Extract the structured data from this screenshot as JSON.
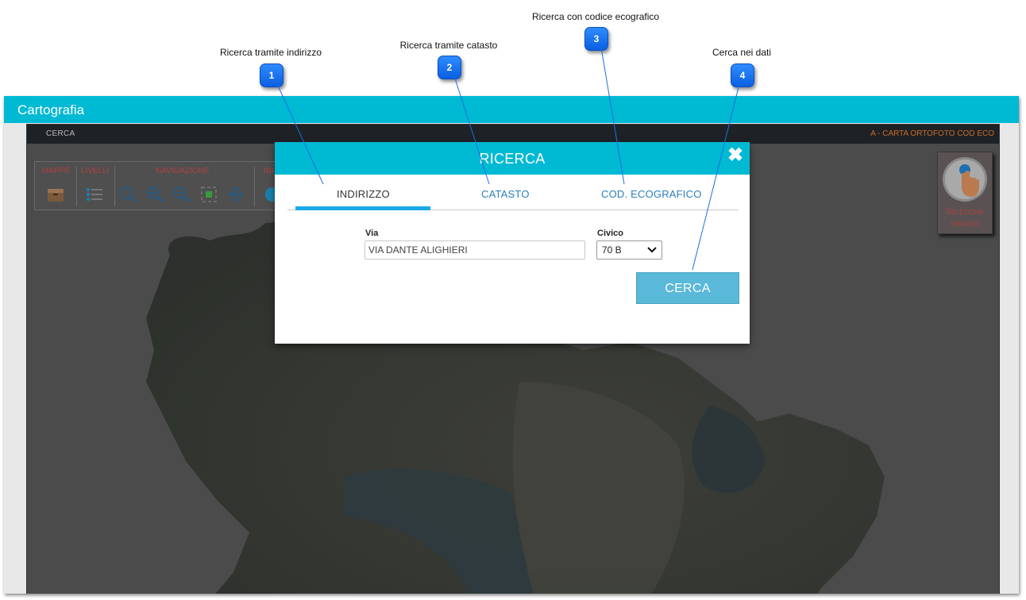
{
  "annotations": [
    {
      "number": "1",
      "label": "Ricerca tramite indirizzo"
    },
    {
      "number": "2",
      "label": "Ricerca tramite catasto"
    },
    {
      "number": "3",
      "label": "Ricerca con codice ecografico"
    },
    {
      "number": "4",
      "label": "Cerca nei dati"
    }
  ],
  "window": {
    "title": "Cartografia"
  },
  "topbar": {
    "search_link": "CERCA",
    "map_name": "A - CARTA ORTOFOTO COD ECO"
  },
  "toolbar": {
    "groups": [
      {
        "label": "MAPPE",
        "icons": [
          "map-archive-icon"
        ]
      },
      {
        "label": "LIVELLI",
        "icons": [
          "layers-list-icon"
        ]
      },
      {
        "label": "NAVIGAZIONE",
        "icons": [
          "search-icon",
          "zoom-in-icon",
          "zoom-out-icon",
          "zoom-extent-icon",
          "pan-icon"
        ]
      },
      {
        "label": "INI",
        "icons": [
          "info-icon"
        ]
      }
    ]
  },
  "select_building": {
    "label_line1": "Seleziona",
    "label_line2": "edificio",
    "icon": "hand-pointer-icon"
  },
  "modal": {
    "title": "RICERCA",
    "close_icon": "close-icon",
    "tabs": [
      {
        "label": "INDIRIZZO",
        "active": true
      },
      {
        "label": "CATASTO",
        "active": false
      },
      {
        "label": "COD. ECOGRAFICO",
        "active": false
      }
    ],
    "via": {
      "label": "Via",
      "value": "VIA DANTE ALIGHIERI"
    },
    "civico": {
      "label": "Civico",
      "value": "70 B"
    },
    "search_button": "CERCA"
  },
  "colors": {
    "accent": "#00b9d3",
    "tab_underline": "#1aa9e6",
    "badge": "#1673f0",
    "button": "#5ab8d8"
  }
}
